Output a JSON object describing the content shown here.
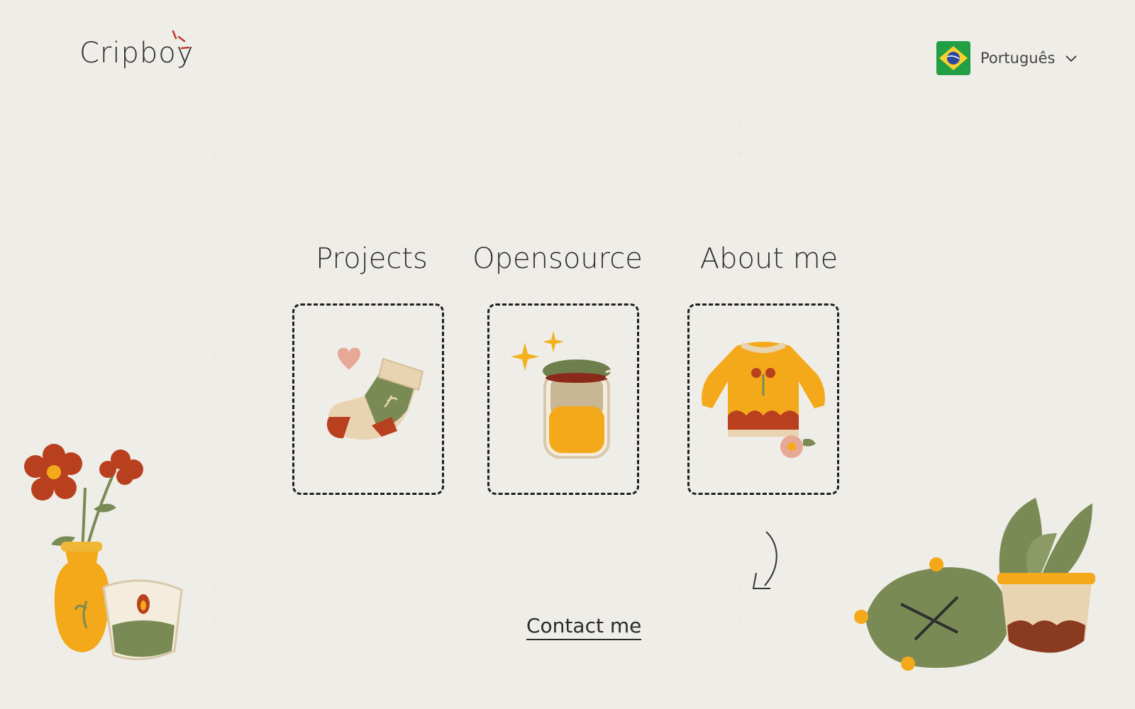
{
  "header": {
    "logo_text": "Cripboy",
    "language": {
      "label": "Português",
      "flag_icon": "brazil-flag-icon"
    }
  },
  "nav": [
    {
      "label": "Projects",
      "icon": "sock-icon"
    },
    {
      "label": "Opensource",
      "icon": "jar-icon"
    },
    {
      "label": "About me",
      "icon": "sweater-icon"
    }
  ],
  "footer": {
    "contact_label": "Contact me"
  },
  "colors": {
    "background": "#efede8",
    "orange": "#f3a91a",
    "olive": "#7a8a55",
    "rust": "#b8401f",
    "cream": "#e9d4b2"
  }
}
